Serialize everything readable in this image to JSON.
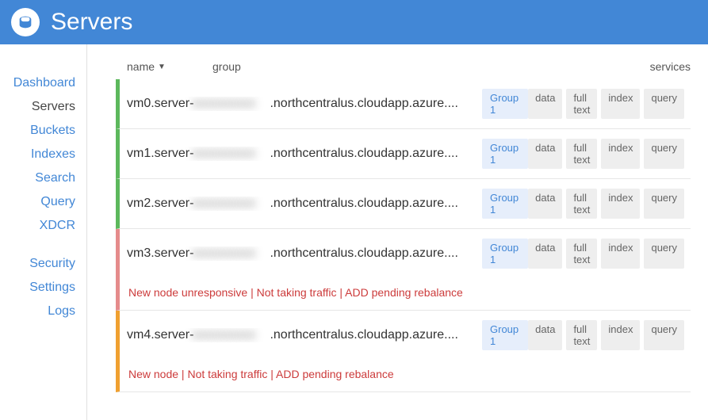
{
  "header": {
    "title": "Servers"
  },
  "sidebar": {
    "items": [
      {
        "label": "Dashboard",
        "active": false
      },
      {
        "label": "Servers",
        "active": true
      },
      {
        "label": "Buckets",
        "active": false
      },
      {
        "label": "Indexes",
        "active": false
      },
      {
        "label": "Search",
        "active": false
      },
      {
        "label": "Query",
        "active": false
      },
      {
        "label": "XDCR",
        "active": false
      }
    ],
    "items2": [
      {
        "label": "Security"
      },
      {
        "label": "Settings"
      },
      {
        "label": "Logs"
      }
    ]
  },
  "columns": {
    "name": "name",
    "group": "group",
    "services": "services"
  },
  "service_labels": {
    "data": "data",
    "fulltext": "full text",
    "index": "index",
    "query": "query"
  },
  "group_label": "Group 1",
  "servers": [
    {
      "prefix": "vm0.server-",
      "redacted": "xxxxxxxxxx",
      "suffix": ".northcentralus.cloudapp.azure....",
      "state": "green",
      "status": ""
    },
    {
      "prefix": "vm1.server-",
      "redacted": "xxxxxxxxxx",
      "suffix": ".northcentralus.cloudapp.azure....",
      "state": "green",
      "status": ""
    },
    {
      "prefix": "vm2.server-",
      "redacted": "xxxxxxxxxx",
      "suffix": ".northcentralus.cloudapp.azure....",
      "state": "green",
      "status": ""
    },
    {
      "prefix": "vm3.server-",
      "redacted": "xxxxxxxxxx",
      "suffix": ".northcentralus.cloudapp.azure....",
      "state": "red",
      "status": "New node unresponsive | Not taking traffic | ADD pending rebalance"
    },
    {
      "prefix": "vm4.server-",
      "redacted": "xxxxxxxxxx",
      "suffix": ".northcentralus.cloudapp.azure....",
      "state": "orange",
      "status": "New node | Not taking traffic | ADD pending rebalance"
    }
  ]
}
